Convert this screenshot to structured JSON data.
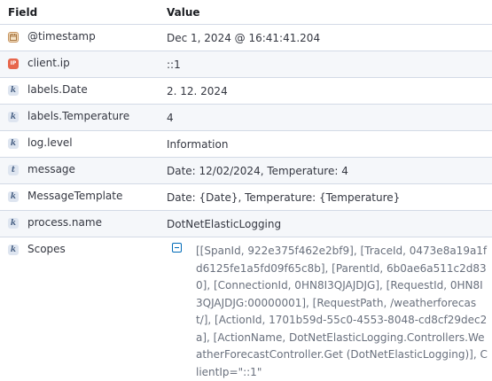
{
  "header": {
    "field": "Field",
    "value": "Value"
  },
  "rows": [
    {
      "icon": "calendar-icon",
      "field": "@timestamp",
      "value": "Dec 1, 2024 @ 16:41:41.204"
    },
    {
      "icon": "ip-icon",
      "icon_text": "IP",
      "field": "client.ip",
      "value": "::1"
    },
    {
      "icon": "keyword-icon",
      "icon_text": "k",
      "field": "labels.Date",
      "value": "2. 12. 2024"
    },
    {
      "icon": "keyword-icon",
      "icon_text": "k",
      "field": "labels.Temperature",
      "value": "4"
    },
    {
      "icon": "keyword-icon",
      "icon_text": "k",
      "field": "log.level",
      "value": "Information"
    },
    {
      "icon": "text-icon",
      "icon_text": "t",
      "field": "message",
      "value": "Date: 12/02/2024, Temperature: 4"
    },
    {
      "icon": "keyword-icon",
      "icon_text": "k",
      "field": "MessageTemplate",
      "value": "Date: {Date}, Temperature: {Temperature}"
    },
    {
      "icon": "keyword-icon",
      "icon_text": "k",
      "field": "process.name",
      "value": "DotNetElasticLogging"
    },
    {
      "icon": "keyword-icon",
      "icon_text": "k",
      "field": "Scopes",
      "value": "[[SpanId, 922e375f462e2bf9], [TraceId, 0473e8a19a1fd6125fe1a5fd09f65c8b], [ParentId, 6b0ae6a511c2d830], [ConnectionId, 0HN8I3QJAJDJG], [RequestId, 0HN8I3QJAJDJG:00000001], [RequestPath, /weatherforecast/], [ActionId, 1701b59d-55c0-4553-8048-cd8cf29dec2a], [ActionName, DotNetElasticLogging.Controllers.WeatherForecastController.Get (DotNetElasticLogging)], ClientIp=\"::1\""
    }
  ]
}
